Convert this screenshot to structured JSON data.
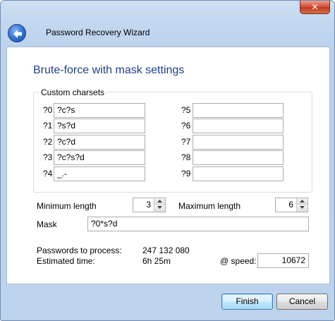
{
  "window": {
    "close_label": "✕",
    "accent": "#1e3f8f"
  },
  "header": {
    "back_icon": "back-arrow-icon",
    "title": "Password Recovery Wizard"
  },
  "main": {
    "heading": "Brute-force with mask settings",
    "charsets": {
      "group_label": "Custom charsets",
      "left": [
        {
          "label": "?0",
          "value": "?c?s"
        },
        {
          "label": "?1",
          "value": "?s?d"
        },
        {
          "label": "?2",
          "value": "?c?d"
        },
        {
          "label": "?3",
          "value": "?c?s?d"
        },
        {
          "label": "?4",
          "value": "_.-"
        }
      ],
      "right": [
        {
          "label": "?5",
          "value": ""
        },
        {
          "label": "?6",
          "value": ""
        },
        {
          "label": "?7",
          "value": ""
        },
        {
          "label": "?8",
          "value": ""
        },
        {
          "label": "?9",
          "value": ""
        }
      ]
    },
    "min_length": {
      "label": "Minimum length",
      "value": "3"
    },
    "max_length": {
      "label": "Maximum length",
      "value": "6"
    },
    "mask": {
      "label": "Mask",
      "value": "?0*s?d"
    },
    "stats": {
      "passwords_label": "Passwords to process:",
      "passwords_value": "247 132 080",
      "time_label": "Estimated time:",
      "time_value": "6h 25m",
      "speed_label": "@ speed:",
      "speed_value": "10672"
    }
  },
  "footer": {
    "finish_label": "Finish",
    "cancel_label": "Cancel"
  }
}
